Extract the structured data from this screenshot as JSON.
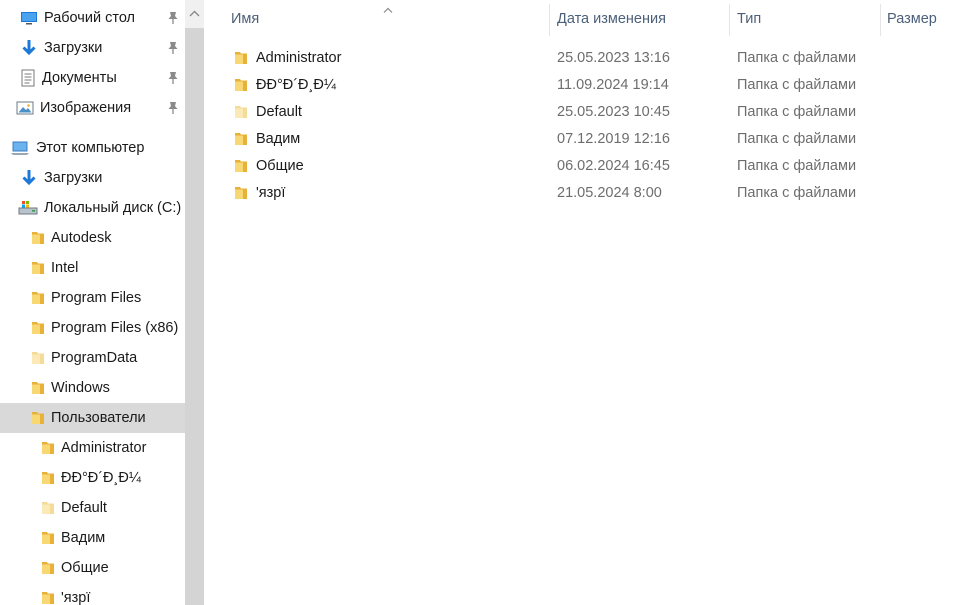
{
  "nav": {
    "items": [
      {
        "label": "Рабочий стол",
        "icon": "desktop-icon",
        "pinned": true
      },
      {
        "label": "Загрузки",
        "icon": "downloads-icon",
        "pinned": true
      },
      {
        "label": "Документы",
        "icon": "documents-icon",
        "pinned": true
      },
      {
        "label": "Изображения",
        "icon": "pictures-icon",
        "pinned": true
      },
      {
        "label": "Этот компьютер",
        "icon": "this-pc-icon"
      },
      {
        "label": "Загрузки",
        "icon": "downloads-icon"
      },
      {
        "label": "Локальный диск (C:)",
        "icon": "local-disk-icon"
      },
      {
        "label": "Autodesk",
        "icon": "folder-icon"
      },
      {
        "label": "Intel",
        "icon": "folder-icon"
      },
      {
        "label": "Program Files",
        "icon": "folder-icon"
      },
      {
        "label": "Program Files (x86)",
        "icon": "folder-icon"
      },
      {
        "label": "ProgramData",
        "icon": "folder-hidden-icon"
      },
      {
        "label": "Windows",
        "icon": "folder-icon"
      },
      {
        "label": "Пользователи",
        "icon": "folder-icon",
        "selected": true
      },
      {
        "label": "Administrator",
        "icon": "folder-icon"
      },
      {
        "label": "ÐÐ°Ð´Ð¸Ð¼",
        "icon": "folder-icon"
      },
      {
        "label": "Default",
        "icon": "folder-hidden-icon"
      },
      {
        "label": "Вадим",
        "icon": "folder-icon"
      },
      {
        "label": "Общие",
        "icon": "folder-icon"
      },
      {
        "label": "'язрї",
        "icon": "folder-icon"
      }
    ]
  },
  "columns": {
    "name": "Имя",
    "date": "Дата изменения",
    "type": "Тип",
    "size": "Размер"
  },
  "files": [
    {
      "name": "Administrator",
      "date": "25.05.2023 13:16",
      "type": "Папка с файлами",
      "icon": "folder-icon"
    },
    {
      "name": "ÐÐ°Ð´Ð¸Ð¼",
      "date": "11.09.2024 19:14",
      "type": "Папка с файлами",
      "icon": "folder-icon"
    },
    {
      "name": "Default",
      "date": "25.05.2023 10:45",
      "type": "Папка с файлами",
      "icon": "folder-hidden-icon"
    },
    {
      "name": "Вадим",
      "date": "07.12.2019 12:16",
      "type": "Папка с файлами",
      "icon": "folder-icon"
    },
    {
      "name": "Общие",
      "date": "06.02.2024 16:45",
      "type": "Папка с файлами",
      "icon": "folder-icon"
    },
    {
      "name": "'язрї",
      "date": "21.05.2024 8:00",
      "type": "Папка с файлами",
      "icon": "folder-icon"
    }
  ],
  "colors": {
    "folder": "#f8d775",
    "folder_dark": "#e8b23a",
    "folder_hidden": "#fbeab8",
    "selected_bg": "#d9d9d9",
    "header_text": "#4c607a",
    "accent_blue": "#1e78d7"
  }
}
